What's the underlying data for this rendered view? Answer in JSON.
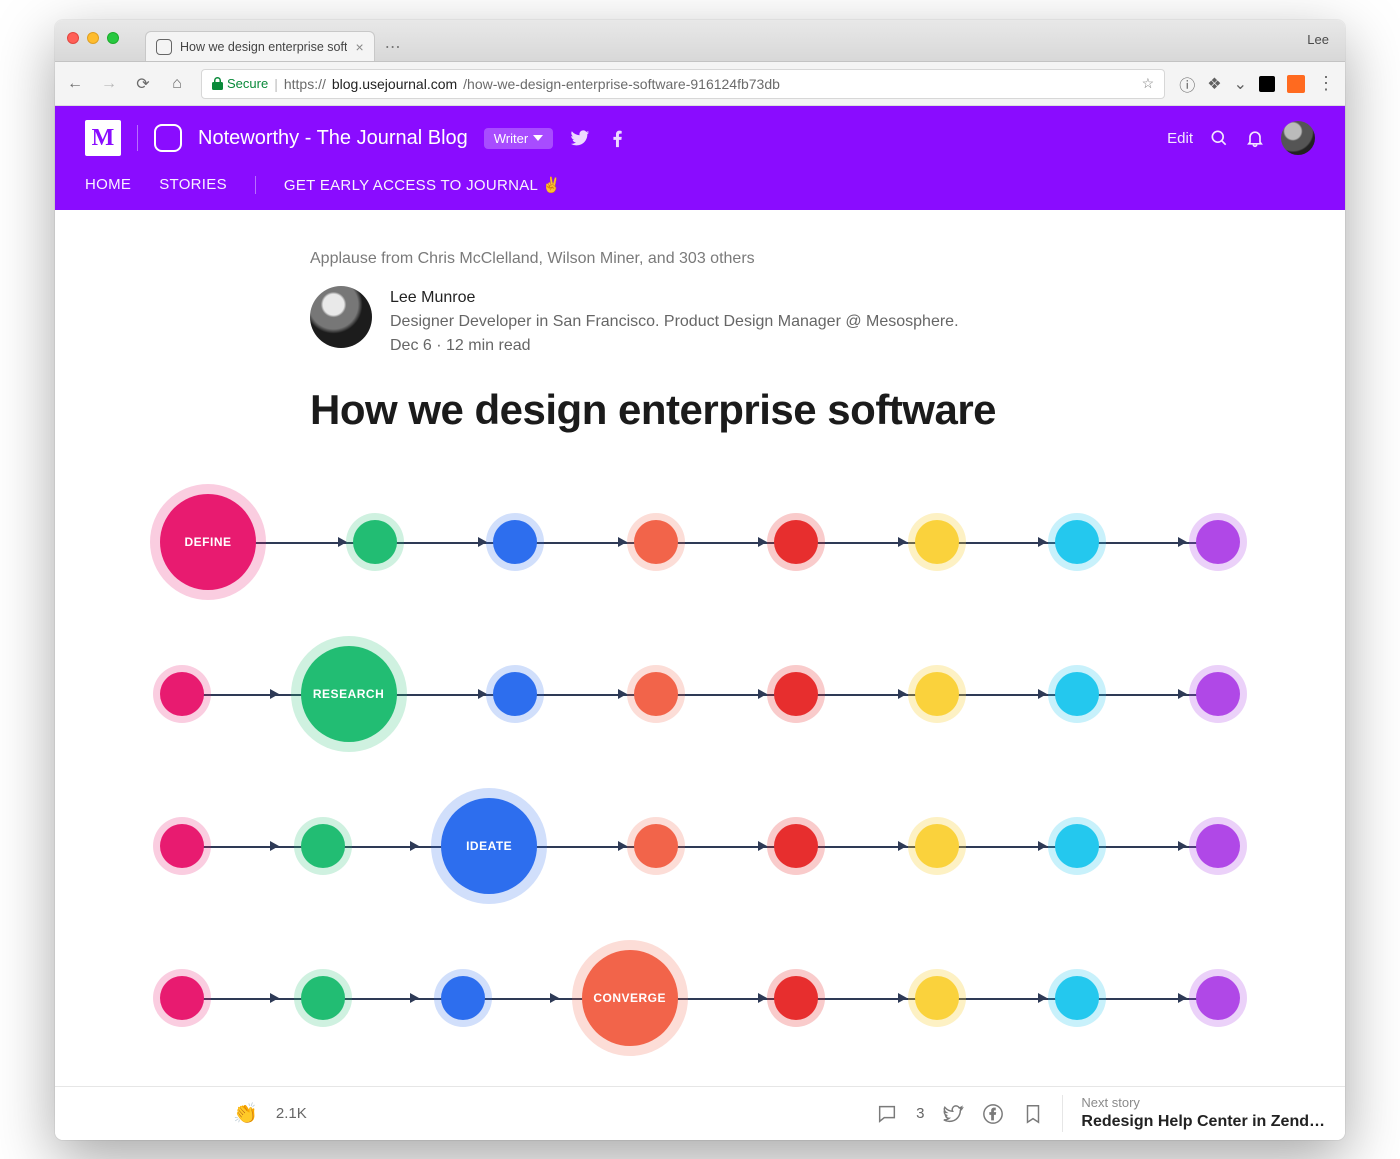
{
  "os": {
    "user_label": "Lee"
  },
  "browser": {
    "tab_title": "How we design enterprise soft",
    "secure_label": "Secure",
    "url_scheme": "https://",
    "url_host": "blog.usejournal.com",
    "url_path": "/how-we-design-enterprise-software-916124fb73db"
  },
  "publication": {
    "name": "Noteworthy - The Journal Blog",
    "badge": "Writer",
    "edit": "Edit",
    "nav": {
      "home": "HOME",
      "stories": "STORIES",
      "early_access": "GET EARLY ACCESS TO JOURNAL ✌️"
    }
  },
  "article": {
    "applause": "Applause from Chris McClelland, Wilson Miner, and 303 others",
    "author_name": "Lee Munroe",
    "author_bio": "Designer Developer in San Francisco. Product Design Manager @ Mesosphere.",
    "meta": "Dec 6 · 12 min read",
    "title": "How we design enterprise software"
  },
  "diagram": {
    "labels": {
      "row1_big": "DEFINE",
      "row2_big": "RESEARCH",
      "row3_big": "IDEATE",
      "row4_big": "CONVERGE"
    }
  },
  "bottombar": {
    "clap_count": "2.1K",
    "comment_count": "3",
    "next_label": "Next story",
    "next_title": "Redesign Help Center in Zend…"
  }
}
